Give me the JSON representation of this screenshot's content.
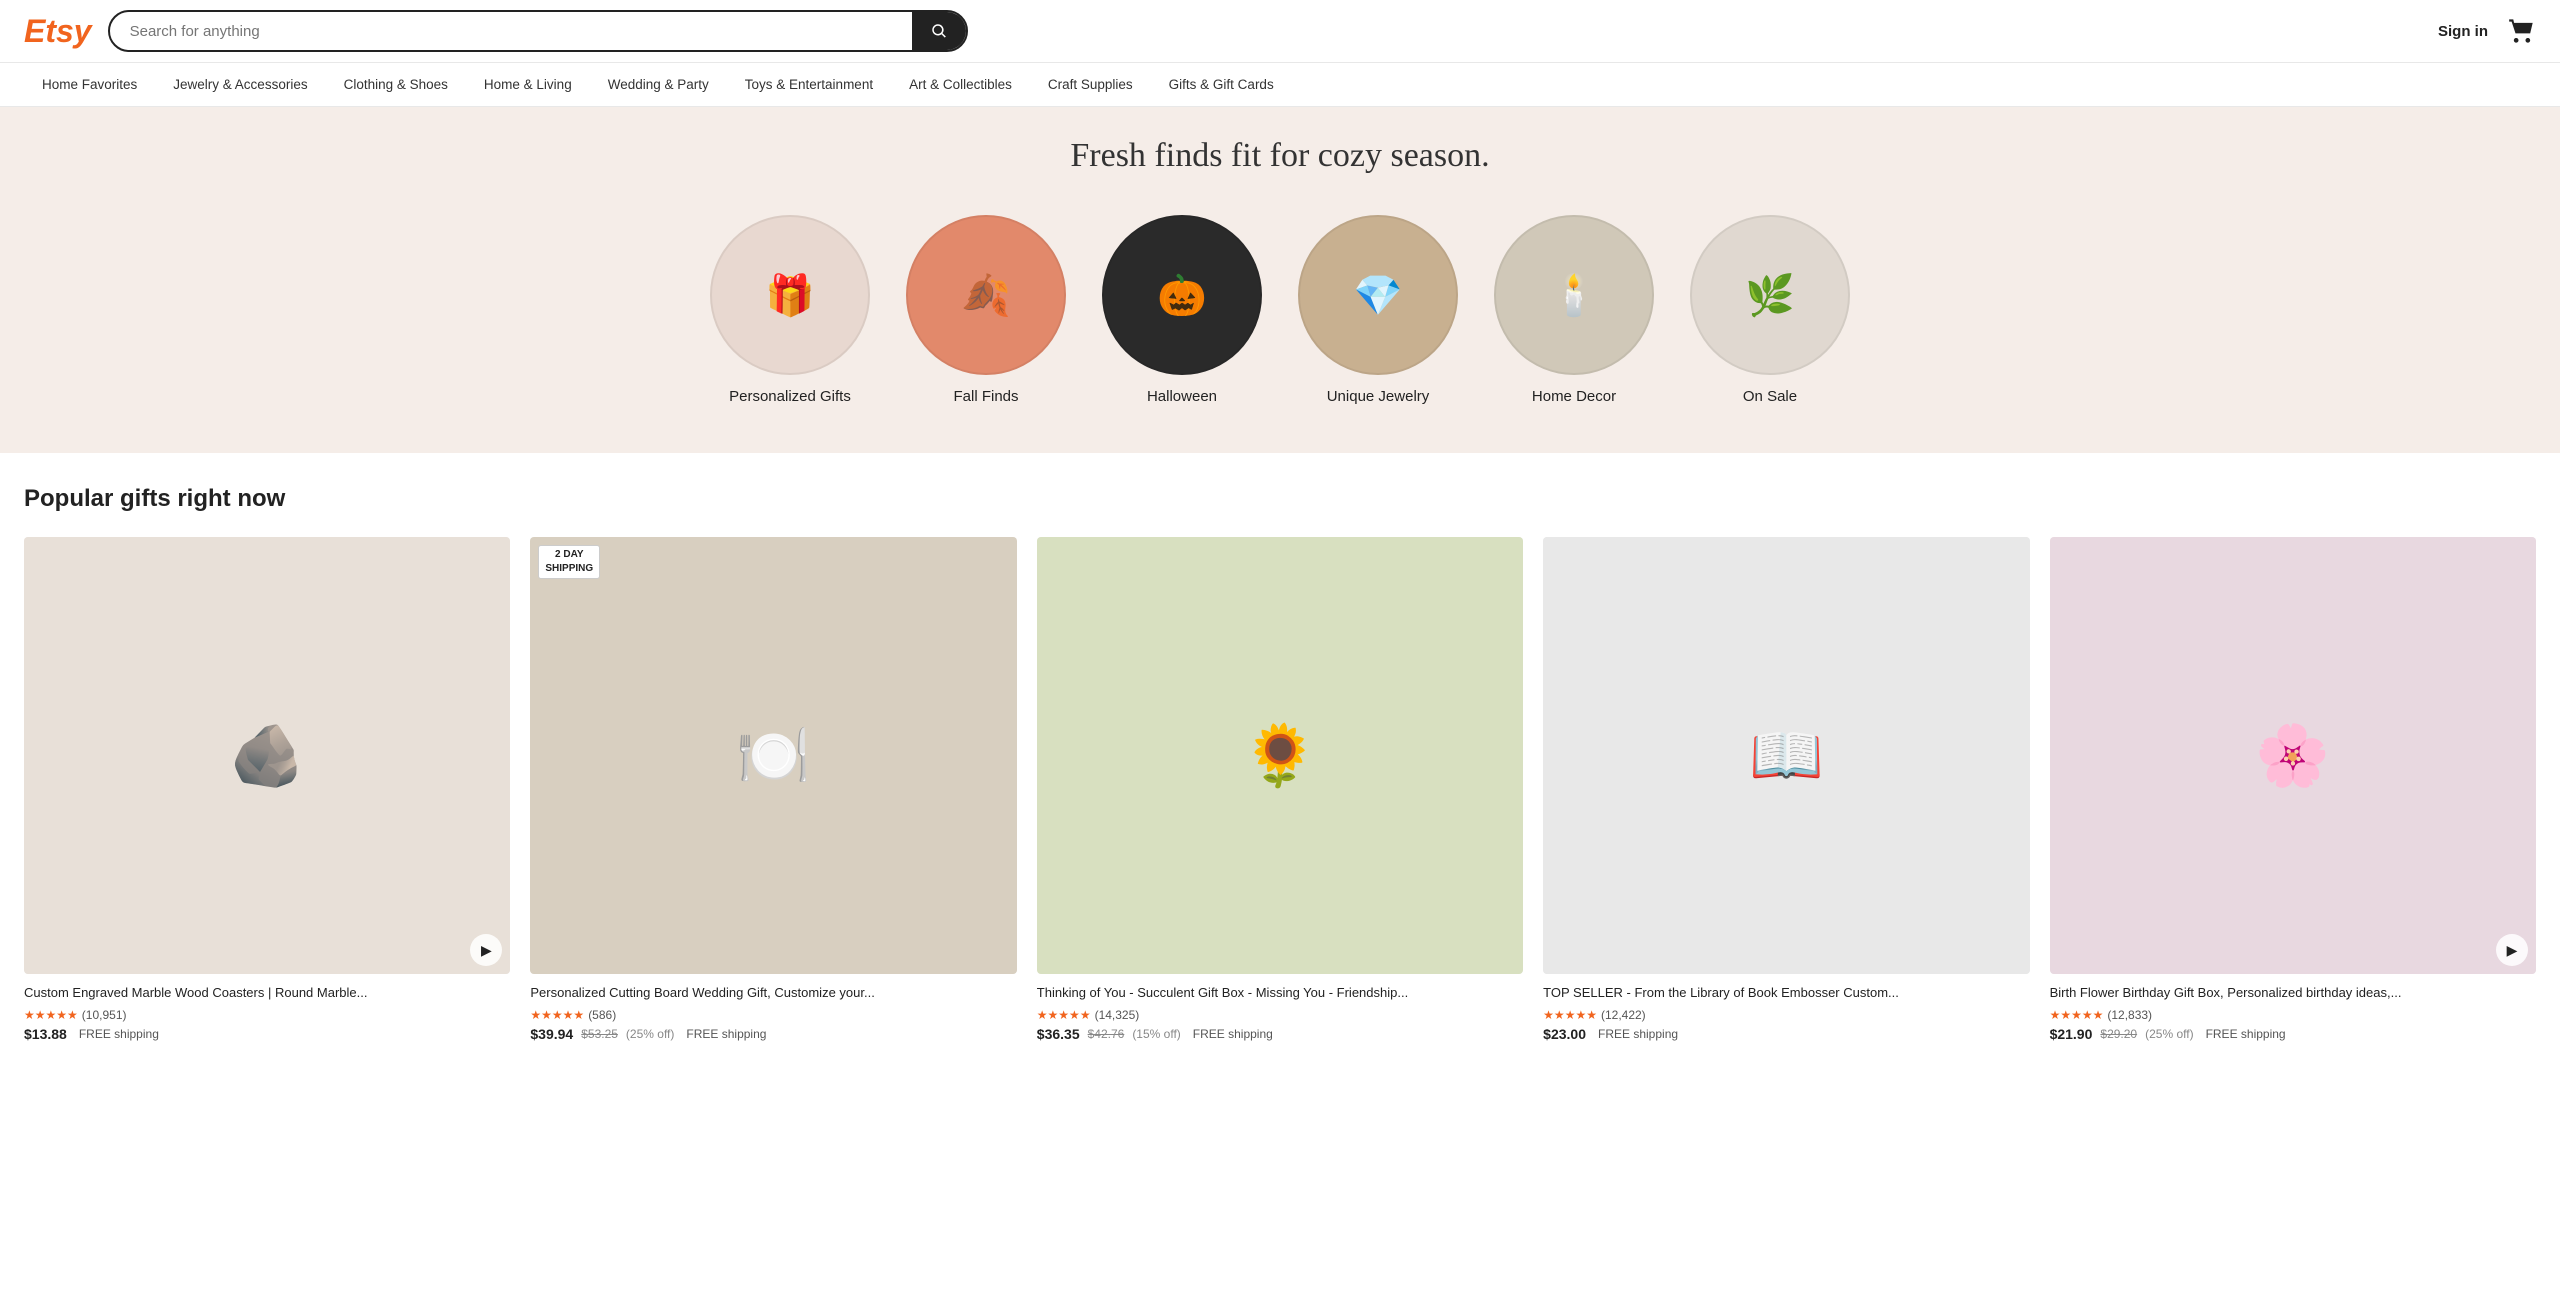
{
  "header": {
    "logo": "Etsy",
    "search_placeholder": "Search for anything",
    "sign_in_label": "Sign in"
  },
  "nav": {
    "items": [
      {
        "label": "Home Favorites"
      },
      {
        "label": "Jewelry & Accessories"
      },
      {
        "label": "Clothing & Shoes"
      },
      {
        "label": "Home & Living"
      },
      {
        "label": "Wedding & Party"
      },
      {
        "label": "Toys & Entertainment"
      },
      {
        "label": "Art & Collectibles"
      },
      {
        "label": "Craft Supplies"
      },
      {
        "label": "Gifts & Gift Cards"
      }
    ]
  },
  "hero": {
    "title": "Fresh finds fit for cozy season."
  },
  "categories": [
    {
      "label": "Personalized Gifts",
      "emoji": "🎁",
      "bg": "#e8d8d0"
    },
    {
      "label": "Fall Finds",
      "emoji": "🍂",
      "bg": "#e2896b"
    },
    {
      "label": "Halloween",
      "emoji": "🎃",
      "bg": "#2a2a2a"
    },
    {
      "label": "Unique Jewelry",
      "emoji": "💎",
      "bg": "#c8b090"
    },
    {
      "label": "Home Decor",
      "emoji": "🕯️",
      "bg": "#d0c8b8"
    },
    {
      "label": "On Sale",
      "emoji": "🌿",
      "bg": "#e0d8d0"
    }
  ],
  "popular_section": {
    "title": "Popular gifts right now",
    "products": [
      {
        "title": "Custom Engraved Marble Wood Coasters | Round Marble...",
        "stars": "★★★★★",
        "reviews": "(10,951)",
        "price": "$13.88",
        "price_orig": "",
        "price_off": "",
        "shipping": "FREE shipping",
        "has_video": true,
        "has_badge": false,
        "emoji": "🪨",
        "bg": "#e8e0d8"
      },
      {
        "title": "Personalized Cutting Board Wedding Gift, Customize your...",
        "stars": "★★★★★",
        "reviews": "(586)",
        "price": "$39.94",
        "price_orig": "$53.25",
        "price_off": "(25% off)",
        "shipping": "FREE shipping",
        "has_video": false,
        "has_badge": true,
        "emoji": "🍽️",
        "bg": "#d8cfc0"
      },
      {
        "title": "Thinking of You - Succulent Gift Box - Missing You - Friendship...",
        "stars": "★★★★★",
        "reviews": "(14,325)",
        "price": "$36.35",
        "price_orig": "$42.76",
        "price_off": "(15% off)",
        "shipping": "FREE shipping",
        "has_video": false,
        "has_badge": false,
        "emoji": "🌻",
        "bg": "#d8e0c0"
      },
      {
        "title": "TOP SELLER - From the Library of Book Embosser Custom...",
        "stars": "★★★★★",
        "reviews": "(12,422)",
        "price": "$23.00",
        "price_orig": "",
        "price_off": "",
        "shipping": "FREE shipping",
        "has_video": false,
        "has_badge": false,
        "emoji": "📖",
        "bg": "#e8e8e8"
      },
      {
        "title": "Birth Flower Birthday Gift Box, Personalized birthday ideas,...",
        "stars": "★★★★★",
        "reviews": "(12,833)",
        "price": "$21.90",
        "price_orig": "$29.20",
        "price_off": "(25% off)",
        "shipping": "FREE shipping",
        "has_video": true,
        "has_badge": false,
        "emoji": "🌸",
        "bg": "#e8d8e0"
      }
    ]
  }
}
